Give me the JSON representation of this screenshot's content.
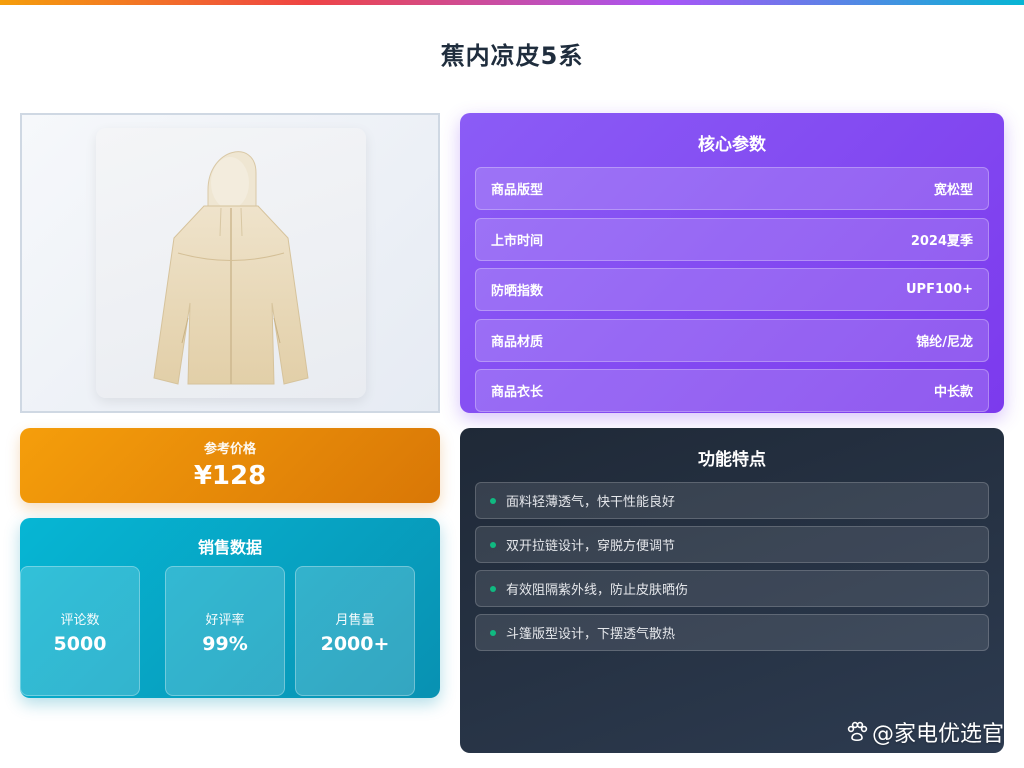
{
  "page_title": "蕉内凉皮5系",
  "price": {
    "label": "参考价格",
    "value": "¥128"
  },
  "sales": {
    "title": "销售数据",
    "stats": [
      {
        "label": "好评率",
        "value": "99%"
      },
      {
        "label": "月售量",
        "value": "2000+"
      },
      {
        "label": "评论数",
        "value": "5000"
      }
    ]
  },
  "specs": {
    "title": "核心参数",
    "rows": [
      {
        "label": "商品版型",
        "value": "宽松型"
      },
      {
        "label": "上市时间",
        "value": "2024夏季"
      },
      {
        "label": "防晒指数",
        "value": "UPF100+"
      },
      {
        "label": "商品材质",
        "value": "锦纶/尼龙"
      },
      {
        "label": "商品衣长",
        "value": "中长款"
      }
    ]
  },
  "features": {
    "title": "功能特点",
    "items": [
      "面料轻薄透气，快干性能良好",
      "双开拉链设计，穿脱方便调节",
      "有效阻隔紫外线，防止皮肤晒伤",
      "斗篷版型设计，下摆透气散热"
    ]
  },
  "watermark": {
    "text": "@家电优选官",
    "icon": "paw-icon"
  },
  "colors": {
    "price_accent": "#f59e0b",
    "sales_accent": "#06b6d4",
    "specs_accent": "#8b5cf6",
    "features_bg": "#1f2937",
    "bullet": "#10b981"
  }
}
